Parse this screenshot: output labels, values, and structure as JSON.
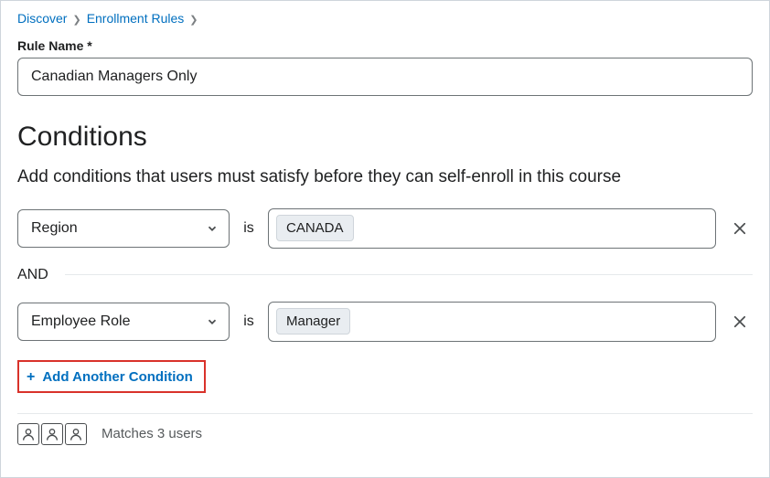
{
  "breadcrumb": {
    "item1": "Discover",
    "item2": "Enrollment Rules"
  },
  "rule_name": {
    "label": "Rule Name *",
    "value": "Canadian Managers Only"
  },
  "conditions": {
    "heading": "Conditions",
    "description": "Add conditions that users must satisfy before they can self-enroll in this course",
    "is_label": "is",
    "and_label": "AND",
    "rows": [
      {
        "attribute": "Region",
        "tag": "CANADA"
      },
      {
        "attribute": "Employee Role",
        "tag": "Manager"
      }
    ],
    "add_button": "Add Another Condition"
  },
  "matches": {
    "text": "Matches 3 users"
  }
}
